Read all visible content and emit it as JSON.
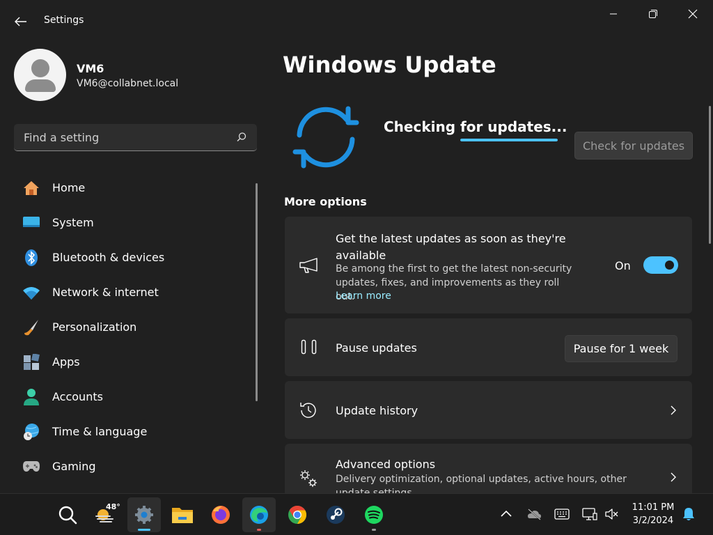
{
  "window": {
    "app_title": "Settings"
  },
  "profile": {
    "name": "VM6",
    "email": "VM6@collabnet.local"
  },
  "search": {
    "placeholder": "Find a setting"
  },
  "nav": {
    "items": [
      {
        "label": "Home",
        "icon": "home-icon"
      },
      {
        "label": "System",
        "icon": "system-icon"
      },
      {
        "label": "Bluetooth & devices",
        "icon": "bluetooth-icon"
      },
      {
        "label": "Network & internet",
        "icon": "wifi-icon"
      },
      {
        "label": "Personalization",
        "icon": "brush-icon"
      },
      {
        "label": "Apps",
        "icon": "apps-icon"
      },
      {
        "label": "Accounts",
        "icon": "accounts-icon"
      },
      {
        "label": "Time & language",
        "icon": "globe-clock-icon"
      },
      {
        "label": "Gaming",
        "icon": "gamepad-icon"
      }
    ]
  },
  "main": {
    "title": "Windows Update",
    "status_text": "Checking for updates...",
    "check_button_label": "Check for updates",
    "more_options_title": "More options",
    "cards": {
      "latest_updates": {
        "title": "Get the latest updates as soon as they're available",
        "description": "Be among the first to get the latest non-security updates, fixes, and improvements as they roll out.",
        "link": "Learn more",
        "toggle_label": "On",
        "toggle_on": true
      },
      "pause_updates": {
        "title": "Pause updates",
        "button_label": "Pause for 1 week"
      },
      "update_history": {
        "title": "Update history"
      },
      "advanced_options": {
        "title": "Advanced options",
        "description": "Delivery optimization, optional updates, active hours, other update settings"
      }
    }
  },
  "taskbar": {
    "weather_temp": "48°",
    "apps": [
      "search-icon",
      "weather-icon",
      "settings-icon",
      "file-explorer-icon",
      "firefox-icon",
      "edge-icon",
      "chrome-icon",
      "steam-icon",
      "spotify-icon"
    ],
    "clock": {
      "time": "11:01 PM",
      "date": "3/2/2024"
    }
  },
  "colors": {
    "accent": "#4cc2ff",
    "background": "#202020",
    "card": "#2b2b2b",
    "link": "#99ebff"
  }
}
